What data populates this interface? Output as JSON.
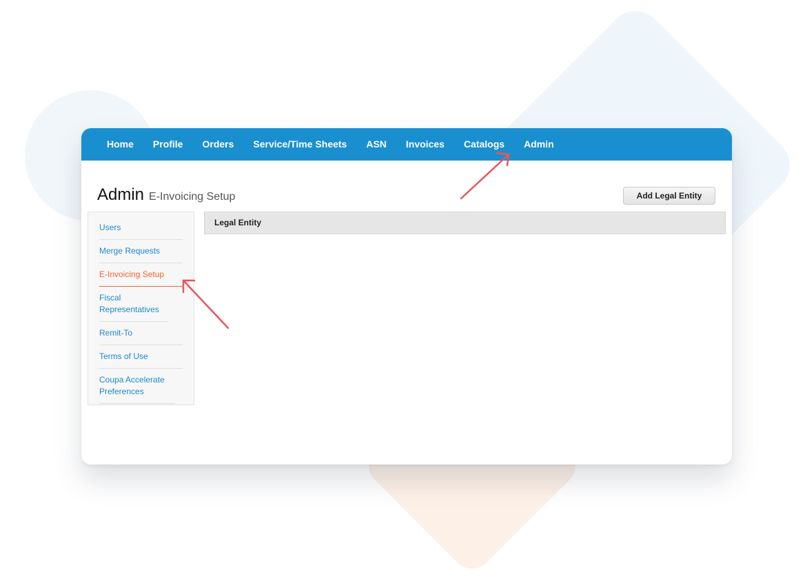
{
  "nav": {
    "items": [
      "Home",
      "Profile",
      "Orders",
      "Service/Time Sheets",
      "ASN",
      "Invoices",
      "Catalogs",
      "Admin"
    ]
  },
  "page": {
    "title": "Admin",
    "subtitle": "E-Invoicing Setup"
  },
  "actions": {
    "add_legal_entity": "Add Legal Entity"
  },
  "sidebar": {
    "items": [
      {
        "label": "Users",
        "active": false
      },
      {
        "label": "Merge Requests",
        "active": false
      },
      {
        "label": "E-Invoicing Setup",
        "active": true
      },
      {
        "label": "Fiscal Representatives",
        "active": false
      },
      {
        "label": "Remit-To",
        "active": false
      },
      {
        "label": "Terms of Use",
        "active": false
      },
      {
        "label": "Coupa Accelerate Preferences",
        "active": false
      }
    ]
  },
  "table": {
    "columns": [
      "Legal Entity"
    ]
  },
  "colors": {
    "nav_bg": "#1a8fd0",
    "link": "#1e88c9",
    "active": "#f0652f",
    "annotation_arrow": "#e8555b"
  },
  "icons": {
    "annotations": [
      "arrow-to-admin-icon",
      "arrow-to-einvoicing-icon"
    ]
  }
}
